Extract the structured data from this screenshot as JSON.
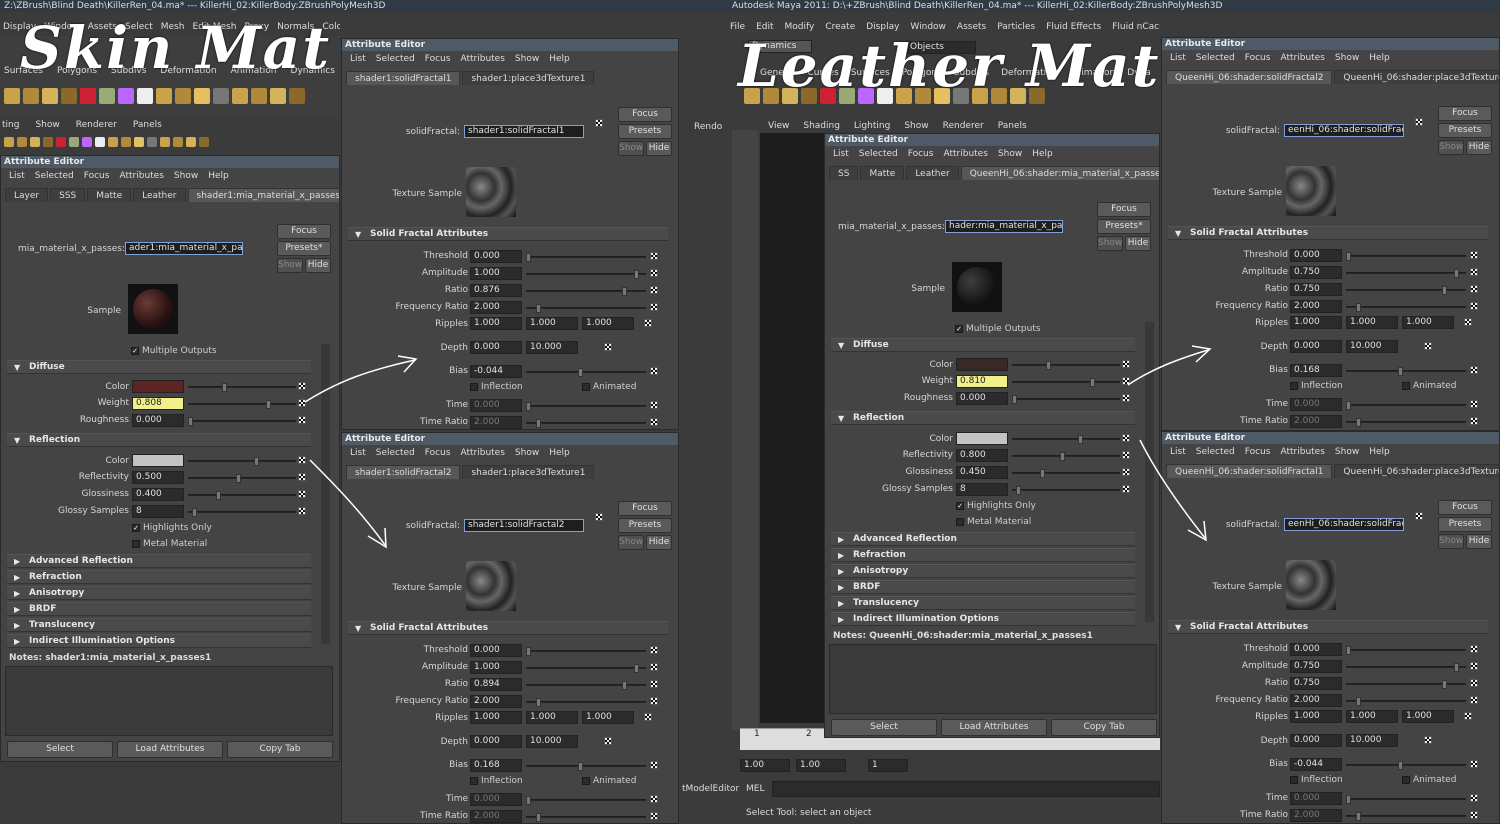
{
  "annotations": {
    "left": "Skin Mat",
    "right": "Leather Mat"
  },
  "left_app": {
    "title": "Z:\\ZBrush\\Blind Death\\KillerRen_04.ma*  ---  KillerHi_02:KillerBody:ZBrushPolyMesh3D",
    "menu": [
      "Display",
      "Window",
      "Assets",
      "Select",
      "Mesh",
      "Edit Mesh",
      "Proxy",
      "Normals",
      "Color",
      "Create UVs",
      "Edit UVs",
      "Help"
    ],
    "shelf_tabs": [
      "Surfaces",
      "Polygons",
      "Subdivs",
      "Deformation",
      "Animation",
      "Dynamics"
    ],
    "panel_menu": [
      "ting",
      "Show",
      "Renderer",
      "Panels"
    ]
  },
  "right_app": {
    "title": "Autodesk Maya 2011: D:\\+ZBrush\\Blind Death\\KillerRen_04.ma*  ---  KillerHi_02:KillerBody:ZBrushPolyMesh3D",
    "menu": [
      "File",
      "Edit",
      "Modify",
      "Create",
      "Display",
      "Window",
      "Assets",
      "Particles",
      "Fluid Effects",
      "Fluid nCache",
      "Fields",
      "Soft/Rigid Bodies",
      "Effects",
      "Solvers",
      "Hair",
      "Help"
    ],
    "mode": "Dynamics",
    "objects": "Objects",
    "shelf_tabs": [
      "General",
      "Curves",
      "Surfaces",
      "Polygons",
      "Subdivs",
      "Deformation",
      "Animation",
      "Dyna"
    ],
    "panel_menu": [
      "View",
      "Shading",
      "Lighting",
      "Show",
      "Renderer",
      "Panels"
    ],
    "time": [
      "1",
      "2"
    ],
    "range": [
      "1.00",
      "1.00",
      "1"
    ],
    "cmd_label": "MEL",
    "help": "Select Tool: select an object",
    "model_editor": "tModelEditor",
    "render_lbl": "Rendo"
  },
  "ae_menu": [
    "List",
    "Selected",
    "Focus",
    "Attributes",
    "Show",
    "Help"
  ],
  "ae_title": "Attribute Editor",
  "common": {
    "focus": "Focus",
    "presets": "Presets",
    "presets_star": "Presets*",
    "show": "Show",
    "hide": "Hide",
    "sample": "Sample",
    "texture_sample": "Texture Sample",
    "select": "Select",
    "load": "Load Attributes",
    "copy": "Copy Tab",
    "multiple_outputs": "Multiple Outputs",
    "highlights_only": "Highlights Only",
    "metal_material": "Metal Material",
    "inflection": "Inflection",
    "animated": "Animated",
    "solid_fractal_attributes": "Solid Fractal Attributes",
    "diffuse": "Diffuse",
    "reflection": "Reflection",
    "advanced_reflection": "Advanced Reflection",
    "refraction": "Refraction",
    "anisotropy": "Anisotropy",
    "brdf": "BRDF",
    "translucency": "Translucency",
    "indirect": "Indirect Illumination Options",
    "lbl": {
      "color": "Color",
      "weight": "Weight",
      "roughness": "Roughness",
      "reflectivity": "Reflectivity",
      "glossiness": "Glossiness",
      "glossy_samples": "Glossy Samples",
      "threshold": "Threshold",
      "amplitude": "Amplitude",
      "ratio": "Ratio",
      "frequency_ratio": "Frequency Ratio",
      "ripples": "Ripples",
      "depth": "Depth",
      "bias": "Bias",
      "time": "Time",
      "time_ratio": "Time Ratio",
      "mia": "mia_material_x_passes:",
      "solid": "solidFractal:"
    }
  },
  "skin_mia": {
    "tabs": [
      "Layer",
      "SSS",
      "Matte",
      "Leather",
      "shader1:mia_material_x_passes1"
    ],
    "name": "ader1:mia_material_x_passes1",
    "weight": "0.808",
    "roughness": "0.000",
    "reflectivity": "0.500",
    "glossiness": "0.400",
    "glossy_samples": "8",
    "notes": "Notes:  shader1:mia_material_x_passes1",
    "color": "#5e2424"
  },
  "skin_f1": {
    "tabs": [
      "shader1:solidFractal1",
      "shader1:place3dTexture1"
    ],
    "name": "shader1:solidFractal1",
    "threshold": "0.000",
    "amplitude": "1.000",
    "ratio": "0.876",
    "freq": "2.000",
    "rip": [
      "1.000",
      "1.000",
      "1.000"
    ],
    "depth": [
      "0.000",
      "10.000"
    ],
    "bias": "-0.044",
    "time": "0.000",
    "time_ratio": "2.000"
  },
  "skin_f2": {
    "tabs": [
      "shader1:solidFractal2",
      "shader1:place3dTexture1"
    ],
    "name": "shader1:solidFractal2",
    "threshold": "0.000",
    "amplitude": "1.000",
    "ratio": "0.894",
    "freq": "2.000",
    "rip": [
      "1.000",
      "1.000",
      "1.000"
    ],
    "depth": [
      "0.000",
      "10.000"
    ],
    "bias": "0.168",
    "time": "0.000",
    "time_ratio": "2.000"
  },
  "leather_mia": {
    "tabs": [
      "SS",
      "Matte",
      "Leather",
      "QueenHi_06:shader:mia_material_x_passes1"
    ],
    "name": "hader:mia_material_x_passes1",
    "weight": "0.810",
    "roughness": "0.000",
    "reflectivity": "0.800",
    "glossiness": "0.450",
    "glossy_samples": "8",
    "notes": "Notes:  QueenHi_06:shader:mia_material_x_passes1",
    "color": "#3a2828"
  },
  "leather_f1": {
    "tabs": [
      "QueenHi_06:shader:solidFractal2",
      "QueenHi_06:shader:place3dTexture1"
    ],
    "name": "eenHi_06:shader:solidFractal2",
    "threshold": "0.000",
    "amplitude": "0.750",
    "ratio": "0.750",
    "freq": "2.000",
    "rip": [
      "1.000",
      "1.000",
      "1.000"
    ],
    "depth": [
      "0.000",
      "10.000"
    ],
    "bias": "0.168",
    "time": "0.000",
    "time_ratio": "2.000"
  },
  "leather_f2": {
    "tabs": [
      "QueenHi_06:shader:solidFractal1",
      "QueenHi_06:shader:place3dTexture1"
    ],
    "name": "eenHi_06:shader:solidFractal1",
    "threshold": "0.000",
    "amplitude": "0.750",
    "ratio": "0.750",
    "freq": "2.000",
    "rip": [
      "1.000",
      "1.000",
      "1.000"
    ],
    "depth": [
      "0.000",
      "10.000"
    ],
    "bias": "-0.044",
    "time": "0.000",
    "time_ratio": "2.000"
  }
}
